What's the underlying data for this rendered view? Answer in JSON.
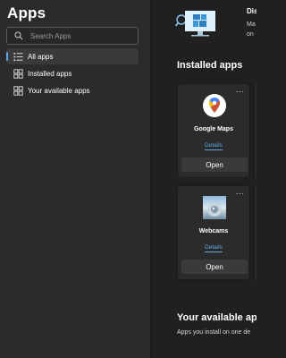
{
  "sidebar": {
    "title": "Apps",
    "search": {
      "placeholder": "Search Apps"
    },
    "items": [
      {
        "label": "All apps",
        "icon": "list-icon",
        "active": true
      },
      {
        "label": "Installed apps",
        "icon": "grid-icon",
        "active": false
      },
      {
        "label": "Your available apps",
        "icon": "grid-icon",
        "active": false
      }
    ]
  },
  "promo": {
    "title": "Dis",
    "line1": "Ma",
    "line2": "on"
  },
  "installed": {
    "title": "Installed apps",
    "apps": [
      {
        "name": "Google Maps",
        "link": "Details",
        "button": "Open",
        "icon": "google-maps-icon"
      },
      {
        "name": "Webcams",
        "link": "Details",
        "button": "Open",
        "icon": "webcams-icon"
      }
    ],
    "more_label": "..."
  },
  "available": {
    "title": "Your available apps",
    "desc": "Apps you install on one de"
  },
  "colors": {
    "accent": "#60a5e8",
    "sidebar_bg": "#2b2b2b",
    "main_bg": "#202020"
  }
}
